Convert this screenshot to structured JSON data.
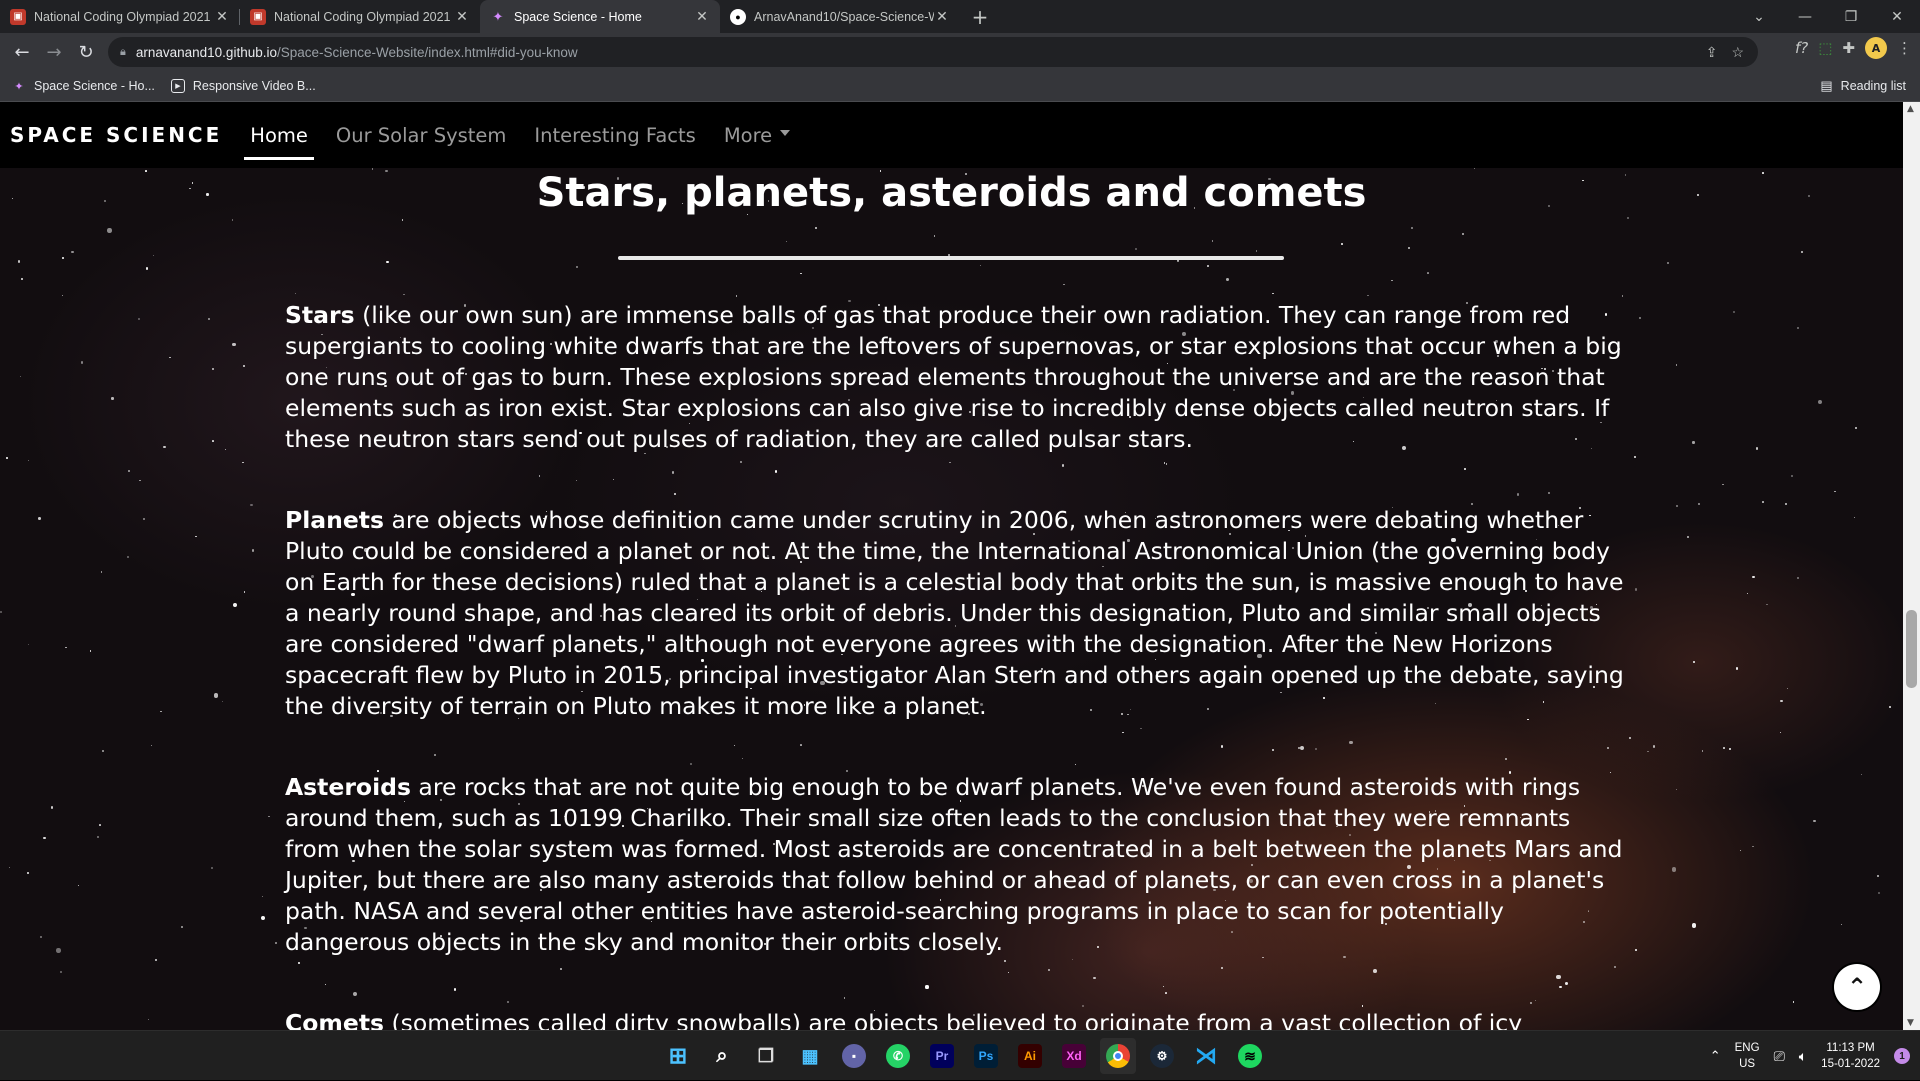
{
  "browser": {
    "tabs": [
      {
        "title": "National Coding Olympiad 2021",
        "active": false
      },
      {
        "title": "National Coding Olympiad 2021",
        "active": false
      },
      {
        "title": "Space Science - Home",
        "active": true
      },
      {
        "title": "ArnavAnand10/Space-Science-W",
        "active": false
      }
    ],
    "url_host": "arnavanand10.github.io",
    "url_path": "/Space-Science-Website/index.html#did-you-know",
    "bookmarks": [
      {
        "label": "Space Science - Ho..."
      },
      {
        "label": "Responsive Video B..."
      }
    ],
    "reading_list": "Reading list"
  },
  "site": {
    "brand": "SPACE SCIENCE",
    "nav": [
      {
        "label": "Home",
        "active": true
      },
      {
        "label": "Our Solar System",
        "active": false
      },
      {
        "label": "Interesting Facts",
        "active": false
      },
      {
        "label": "More",
        "active": false
      }
    ],
    "heading": "Stars, planets, asteroids and comets",
    "paragraphs": [
      {
        "term": "Stars",
        "text": " (like our own sun) are immense balls of gas that produce their own radiation. They can range from red supergiants to cooling white dwarfs that are the leftovers of supernovas, or star explosions that occur when a big one runs out of gas to burn. These explosions spread elements throughout the universe and are the reason that elements such as iron exist. Star explosions can also give rise to incredibly dense objects called neutron stars. If these neutron stars send out pulses of radiation, they are called pulsar stars."
      },
      {
        "term": "Planets",
        "text": " are objects whose definition came under scrutiny in 2006, when astronomers were debating whether Pluto could be considered a planet or not. At the time, the International Astronomical Union (the governing body on Earth for these decisions) ruled that a planet is a celestial body that orbits the sun, is massive enough to have a nearly round shape, and has cleared its orbit of debris. Under this designation, Pluto and similar small objects are considered \"dwarf planets,\" although not everyone agrees with the designation. After the New Horizons spacecraft flew by Pluto in 2015, principal investigator Alan Stern and others again opened up the debate, saying the diversity of terrain on Pluto makes it more like a planet."
      },
      {
        "term": "Asteroids",
        "text": " are rocks that are not quite big enough to be dwarf planets. We've even found asteroids with rings around them, such as 10199 Charilko. Their small size often leads to the conclusion that they were remnants from when the solar system was formed. Most asteroids are concentrated in a belt between the planets Mars and Jupiter, but there are also many asteroids that follow behind or ahead of planets, or can even cross in a planet's path. NASA and several other entities have asteroid-searching programs in place to scan for potentially dangerous objects in the sky and monitor their orbits closely."
      },
      {
        "term": "Comets",
        "text": " (sometimes called dirty snowballs) are objects believed to originate from a vast collection of icy"
      }
    ]
  },
  "taskbar": {
    "lang_top": "ENG",
    "lang_bottom": "US",
    "time": "11:13 PM",
    "date": "15-01-2022",
    "notifications": "1"
  }
}
